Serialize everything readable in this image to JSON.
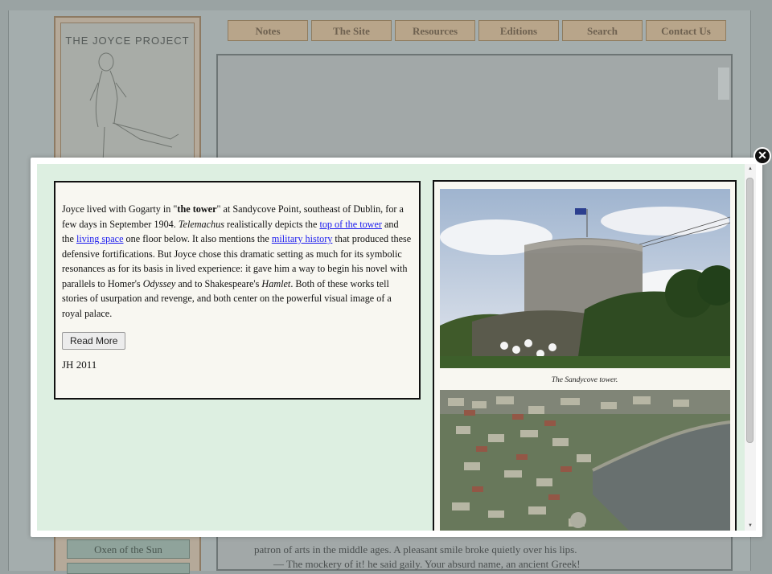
{
  "site": {
    "logo_title": "THE JOYCE PROJECT",
    "nav": [
      "Notes",
      "The Site",
      "Resources",
      "Editions",
      "Search",
      "Contact Us"
    ],
    "side_button": "Oxen of  the Sun",
    "background_lines": [
      "patron of arts in the middle ages. A pleasant smile broke quietly over his lips.",
      "— The mockery of it! he said gaily. Your absurd name, an ancient Greek!"
    ]
  },
  "modal": {
    "intro_1": "Joyce lived with Gogarty in \"",
    "bold_term": "the tower",
    "intro_2": "\" at Sandycove Point, southeast of Dublin, for a few days in September 1904. ",
    "telemachus": "Telemachus",
    "intro_3": " realistically depicts the ",
    "link_top": "top of the tower",
    "text_and": " and the ",
    "link_living": "living space",
    "text_below": " one floor below. It also mentions the ",
    "link_military": "military history",
    "text_rest": " that produced these defensive fortifications. But Joyce chose this dramatic setting as much for its symbolic resonances as for its basis in lived experience: it gave him a way to begin his novel with parallels to Homer's ",
    "odyssey": "Odyssey",
    "text_to": " and to Shakespeare's ",
    "hamlet": "Hamlet",
    "text_end": ". Both of these works tell stories of usurpation and revenge, and both center on the powerful visual image of a royal palace.",
    "read_more": "Read More",
    "signature": "JH 2011",
    "caption_tower": "The Sandycove tower.",
    "close_symbol": "✕"
  },
  "colors": {
    "modal_bg": "#ddefe1",
    "panel_bg": "#f8f7f1",
    "link": "#1a1aee",
    "tab_bg": "#b8a58a"
  }
}
